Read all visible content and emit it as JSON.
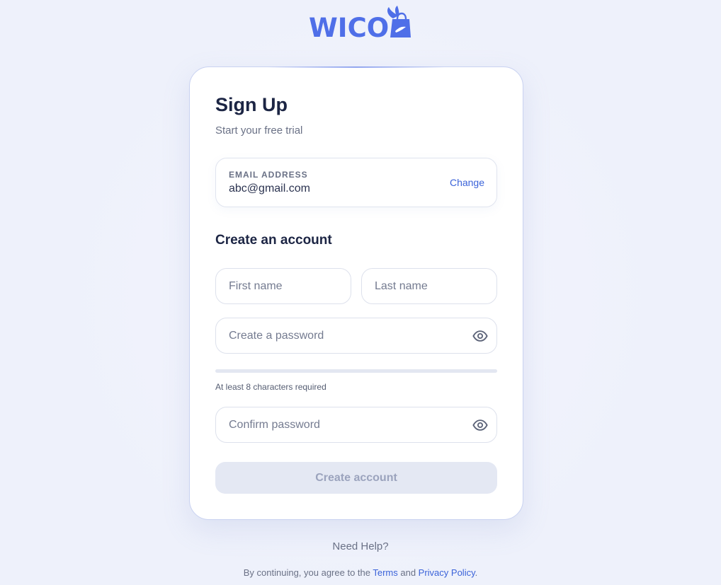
{
  "brand": {
    "name": "WICO",
    "logo_icon": "shopping-bag-with-wing-icon",
    "color": "#4f6fe8"
  },
  "form": {
    "title": "Sign Up",
    "subtitle": "Start your free trial",
    "email": {
      "label": "EMAIL ADDRESS",
      "value": "abc@gmail.com",
      "change_label": "Change"
    },
    "section_title": "Create an account",
    "first_name": {
      "placeholder": "First name",
      "value": ""
    },
    "last_name": {
      "placeholder": "Last name",
      "value": ""
    },
    "password": {
      "placeholder": "Create a password",
      "value": "",
      "icon": "eye-icon"
    },
    "password_strength": 0,
    "password_hint": "At least 8 characters required",
    "confirm_password": {
      "placeholder": "Confirm password",
      "value": "",
      "icon": "eye-icon"
    },
    "submit_label": "Create account",
    "submit_disabled": true
  },
  "footer": {
    "help_label": "Need Help?",
    "legal_prefix": "By continuing, you agree to the ",
    "terms_label": "Terms",
    "legal_and": " and ",
    "privacy_label": "Privacy Policy",
    "legal_suffix": "."
  },
  "colors": {
    "accent": "#4f6fe8",
    "link": "#3b63d9",
    "heading": "#1c2544",
    "disabled_button_bg": "#e4e8f3",
    "disabled_button_text": "#9ba3bd"
  }
}
